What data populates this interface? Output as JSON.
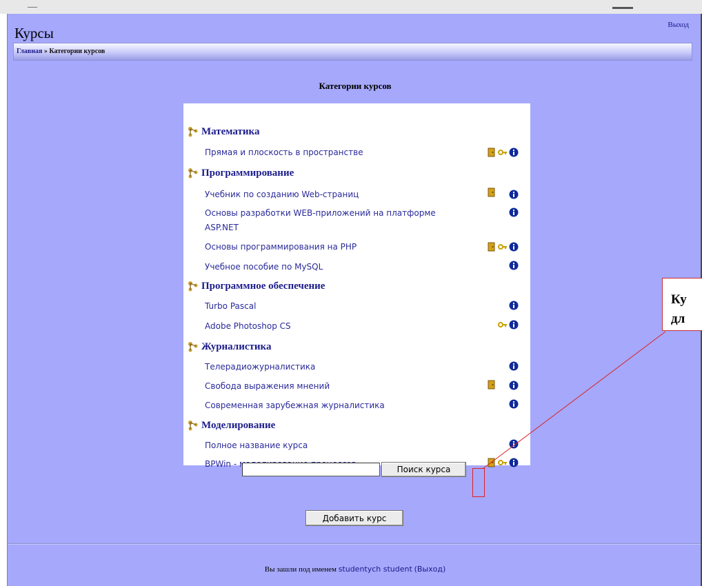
{
  "header": {
    "title": "Курсы",
    "logout_label": "Выход",
    "breadcrumb": {
      "home": "Главная",
      "separator": " » ",
      "current": "Категории курсов"
    }
  },
  "main": {
    "section_title": "Категории курсов",
    "categories": [
      {
        "name": "Математика",
        "courses": [
          {
            "title": "Прямая и плоскость в пространстве",
            "icons": [
              "door-icon",
              "key-icon",
              "info-icon"
            ]
          }
        ]
      },
      {
        "name": "Программирование",
        "courses": [
          {
            "title": "Учебник по созданию Web-страниц",
            "icons": [
              "door-icon",
              "info-icon"
            ]
          },
          {
            "title": "Основы разработки WEB-приложений на платформе ASP.NET",
            "icons": [
              "info-icon"
            ]
          },
          {
            "title": "Основы программирования на PHP",
            "icons": [
              "door-icon",
              "key-icon",
              "info-icon"
            ]
          },
          {
            "title": "Учебное пособие по MySQL",
            "icons": [
              "info-icon"
            ]
          }
        ]
      },
      {
        "name": "Программное обеспечение",
        "courses": [
          {
            "title": "Turbo Pascal",
            "icons": [
              "info-icon"
            ]
          },
          {
            "title": "Adobe Photoshop CS",
            "icons": [
              "key-icon",
              "info-icon"
            ]
          }
        ]
      },
      {
        "name": "Журналистика",
        "courses": [
          {
            "title": "Телерадиожурналистика",
            "icons": [
              "info-icon"
            ]
          },
          {
            "title": "Свобода выражения мнений",
            "icons": [
              "door-icon",
              "info-icon"
            ]
          },
          {
            "title": "Современная зарубежная журналистика",
            "icons": [
              "info-icon"
            ]
          }
        ]
      },
      {
        "name": "Моделирование",
        "courses": [
          {
            "title": "Полное название курса",
            "icons": [
              "info-icon"
            ]
          },
          {
            "title": "BPWin - моделирование процессов",
            "icons": [
              "door-icon",
              "key-icon",
              "info-icon"
            ]
          }
        ]
      }
    ],
    "search": {
      "value": "",
      "button_label": "Поиск курса"
    },
    "add_course_label": "Добавить курс"
  },
  "footer": {
    "logged_in_text": "Вы зашли под именем",
    "username": "studentych student",
    "logout_label": "Выход"
  },
  "callout": {
    "line1": "Ку",
    "line2": "дл"
  },
  "colors": {
    "page_bg": "#a5a8fb",
    "link": "#1c1c8c",
    "icon_gold": "#d4a017",
    "icon_info": "#102a9a",
    "callout_border": "#e02020"
  }
}
